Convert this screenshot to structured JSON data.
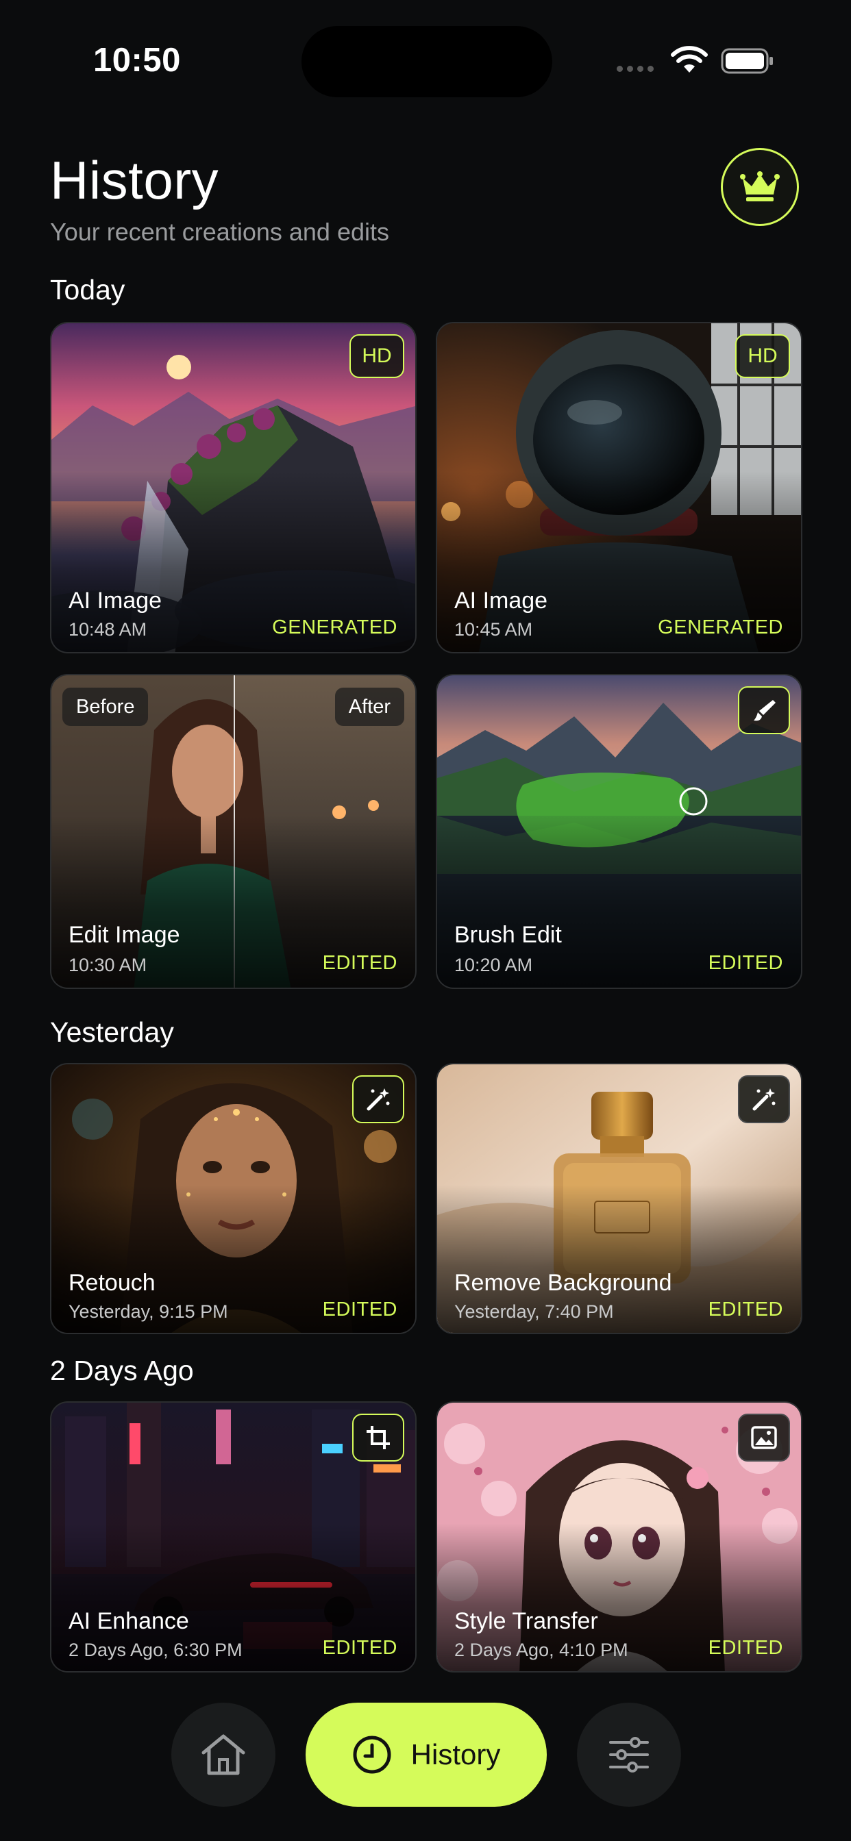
{
  "status_bar": {
    "time": "10:50"
  },
  "header": {
    "title": "History",
    "subtitle": "Your recent creations and edits"
  },
  "sections": {
    "today": "Today",
    "yesterday": "Yesterday",
    "two_days": "2 Days Ago"
  },
  "cards": [
    {
      "title": "AI Image",
      "time": "10:48 AM",
      "status": "GENERATED",
      "badge": "HD"
    },
    {
      "title": "AI Image",
      "time": "10:45 AM",
      "status": "GENERATED",
      "badge": "HD"
    },
    {
      "title": "Edit Image",
      "time": "10:30 AM",
      "status": "EDITED",
      "before": "Before",
      "after": "After"
    },
    {
      "title": "Brush Edit",
      "time": "10:20 AM",
      "status": "EDITED",
      "icon": "brush-icon"
    },
    {
      "title": "Retouch",
      "time": "Yesterday, 9:15 PM",
      "status": "EDITED",
      "icon": "magic-wand-icon"
    },
    {
      "title": "Remove Background",
      "time": "Yesterday, 7:40 PM",
      "status": "EDITED",
      "icon": "magic-wand-icon"
    },
    {
      "title": "AI Enhance",
      "time": "2 Days Ago, 6:30 PM",
      "status": "EDITED",
      "icon": "crop-icon"
    },
    {
      "title": "Style Transfer",
      "time": "2 Days Ago, 4:10 PM",
      "status": "EDITED",
      "icon": "image-icon"
    }
  ],
  "nav": {
    "home_icon": "home-icon",
    "history_label": "History",
    "settings_icon": "sliders-icon"
  },
  "colors": {
    "accent": "#d5fb5a",
    "background": "#0b0c0d"
  }
}
